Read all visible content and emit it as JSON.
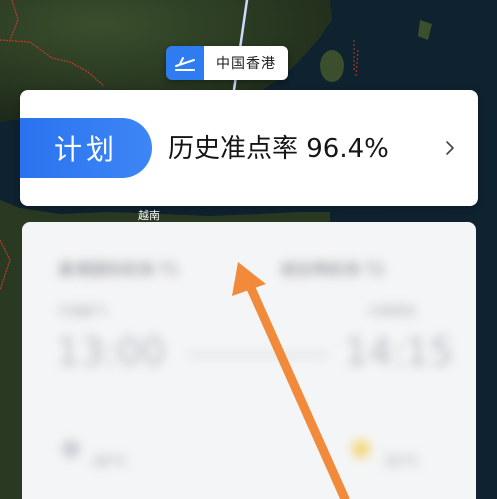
{
  "map": {
    "region_label": "越南",
    "colors": {
      "land": "#2c3f25",
      "sea": "#0f2230",
      "border": "#c0392b",
      "flight_path": "#cfd8ff"
    }
  },
  "departure": {
    "airport_name": "中国香港",
    "icon": "plane-takeoff-icon",
    "accent": "#2f7bf0"
  },
  "plan_card": {
    "badge_label": "计划",
    "ontime_label": "历史准点率 96.4%",
    "chevron_icon": "chevron-right-icon"
  },
  "flight_detail": {
    "departure_airport": "香港国际机场 T1",
    "arrival_airport": "胡志明机场 T2",
    "departure_label": "计划起飞",
    "arrival_label": "计划到达",
    "departure_time": "13:00",
    "arrival_time": "14:15",
    "departure_weather": "26°C",
    "arrival_weather": "33°C"
  },
  "annotation": {
    "arrow_color": "#f28a3b"
  }
}
